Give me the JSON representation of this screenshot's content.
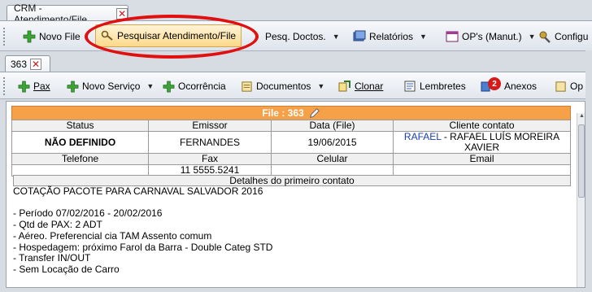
{
  "outer_tab": {
    "label": "CRM -Atendimento/File"
  },
  "toolbar": {
    "novo_file": "Novo File",
    "pesquisar": "Pesquisar Atendimento/File",
    "pesq_doctos": "Pesq. Doctos.",
    "relatorios": "Relatórios",
    "ops": "OP's (Manut.)",
    "config": "Configu"
  },
  "inner_tab": {
    "label": "363"
  },
  "toolbar2": {
    "pax": "Pax",
    "novo_servico": "Novo Serviço",
    "ocorrencia": "Ocorrência",
    "documentos": "Documentos",
    "clonar": "Clonar",
    "lembretes": "Lembretes",
    "anexos_count": "2",
    "anexos": "Anexos",
    "op": "Op"
  },
  "file": {
    "title": "File : 363",
    "headers": {
      "status": "Status",
      "emissor": "Emissor",
      "data": "Data (File)",
      "cliente": "Cliente contato"
    },
    "status": "NÃO DEFINIDO",
    "emissor": "FERNANDES",
    "data": "19/06/2015",
    "cliente_link": "RAFAEL",
    "cliente_rest": " - RAFAEL LUÍS MOREIRA XAVIER",
    "headers2": {
      "telefone": "Telefone",
      "fax": "Fax",
      "celular": "Celular",
      "email": "Email"
    },
    "telefone": "",
    "fax": "11 5555.5241",
    "celular": "",
    "email": "",
    "detalhes_header": "Detalhes do primeiro contato",
    "detalhes": "COTAÇÃO PACOTE PARA CARNAVAL SALVADOR 2016\n\n- Período 07/02/2016 - 20/02/2016\n- Qtd de PAX: 2 ADT\n- Aéreo. Preferencial cia TAM Assento comum\n- Hospedagem: próximo Farol da Barra - Double Categ STD\n- Transfer IN/OUT\n- Sem Locação de Carro"
  },
  "colors": {
    "accent_orange": "#f6a048",
    "highlight": "#fbd98a",
    "annotation_red": "#e01010",
    "link_blue": "#1a3fb0"
  }
}
